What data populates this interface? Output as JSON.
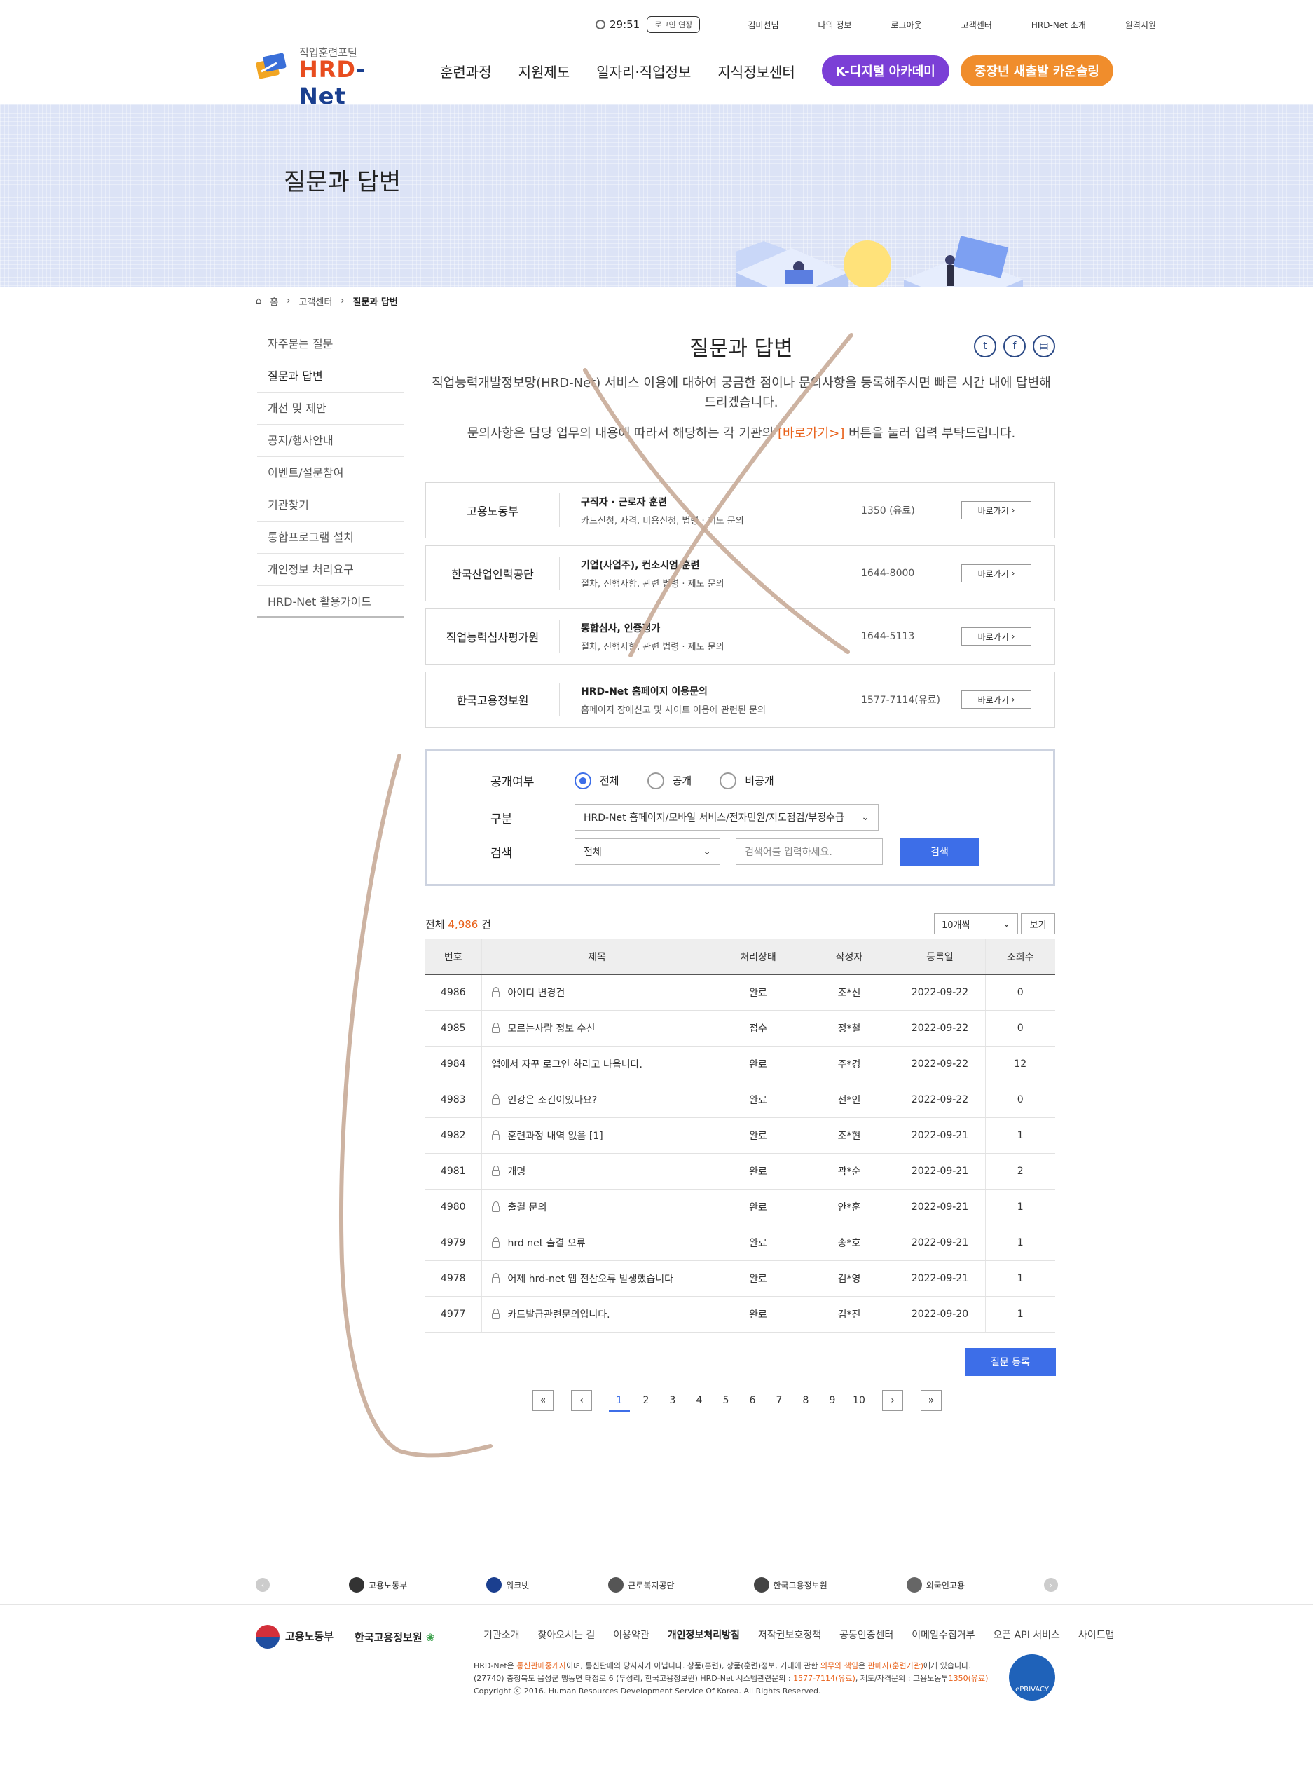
{
  "util": {
    "timer": "29:51",
    "extend_label": "로그인 연장",
    "user": "김미선님",
    "links": [
      "나의 정보",
      "로그아웃",
      "고객센터",
      "HRD-Net 소개",
      "원격지원"
    ]
  },
  "logo": {
    "small": "직업훈련포털",
    "brand_a": "HRD",
    "brand_b": "-Net"
  },
  "nav": {
    "items": [
      "훈련과정",
      "지원제도",
      "일자리·직업정보",
      "지식정보센터"
    ],
    "pill_digital": "K-디지털 아카데미",
    "pill_counsel": "중장년 새출발 카운슬링"
  },
  "banner": {
    "title": "질문과 답변"
  },
  "breadcrumb": {
    "home": "홈",
    "level1": "고객센터",
    "current": "질문과 답변"
  },
  "sidebar": {
    "items": [
      "자주묻는 질문",
      "질문과 답변",
      "개선 및 제안",
      "공지/행사안내",
      "이벤트/설문참여",
      "기관찾기",
      "통합프로그램 설치",
      "개인정보 처리요구",
      "HRD-Net 활용가이드"
    ]
  },
  "content": {
    "title": "질문과 답변",
    "intro": "직업능력개발정보망(HRD-Net) 서비스 이용에 대하여 궁금한 점이나 문의사항을 등록해주시면 빠른 시간 내에 답변해 드리겠습니다.",
    "intro2_a": "문의사항은 담당 업무의 내용에 따라서 해당하는 각 기관의",
    "intro2_hl": "[바로가기>]",
    "intro2_b": "버튼을 눌러 입력 부탁드립니다."
  },
  "agencies": [
    {
      "name": "고용노동부",
      "title": "구직자 · 근로자 훈련",
      "sub": "카드신청, 자격, 비용신청, 법령 · 제도 문의",
      "phone": "1350 (유료)",
      "go": "바로가기"
    },
    {
      "name": "한국산업인력공단",
      "title": "기업(사업주), 컨소시엄 훈련",
      "sub": "절차, 진행사항, 관련 법령 · 제도 문의",
      "phone": "1644-8000",
      "go": "바로가기"
    },
    {
      "name": "직업능력심사평가원",
      "title": "통합심사, 인증평가",
      "sub": "절차, 진행사항, 관련 법령 · 제도 문의",
      "phone": "1644-5113",
      "go": "바로가기"
    },
    {
      "name": "한국고용정보원",
      "title": "HRD-Net 홈페이지 이용문의",
      "sub": "홈페이지 장애신고 및 사이트 이용에 관련된 문의",
      "phone": "1577-7114(유료)",
      "go": "바로가기"
    }
  ],
  "search": {
    "public_label": "공개여부",
    "radio_all": "전체",
    "radio_public": "공개",
    "radio_private": "비공개",
    "category_label": "구분",
    "category_value": "HRD-Net 홈페이지/모바일 서비스/전자민원/지도점검/부정수급",
    "search_label": "검색",
    "field_value": "전체",
    "keyword_placeholder": "검색어를 입력하세요.",
    "button": "검색"
  },
  "list": {
    "total_prefix": "전체",
    "total_count": "4,986",
    "total_suffix": "건",
    "page_size": "10개씩",
    "view_button": "보기",
    "columns": [
      "번호",
      "제목",
      "처리상태",
      "작성자",
      "등록일",
      "조회수"
    ],
    "rows": [
      {
        "no": "4986",
        "title": "아이디 변경건",
        "locked": true,
        "status": "완료",
        "author": "조*신",
        "date": "2022-09-22",
        "views": "0"
      },
      {
        "no": "4985",
        "title": "모르는사람 정보 수신",
        "locked": true,
        "status": "접수",
        "author": "정*철",
        "date": "2022-09-22",
        "views": "0"
      },
      {
        "no": "4984",
        "title": "앱에서 자꾸 로그인 하라고 나옵니다.",
        "locked": false,
        "status": "완료",
        "author": "주*경",
        "date": "2022-09-22",
        "views": "12"
      },
      {
        "no": "4983",
        "title": "인강은 조건이있나요?",
        "locked": true,
        "status": "완료",
        "author": "전*인",
        "date": "2022-09-22",
        "views": "0"
      },
      {
        "no": "4982",
        "title": "훈련과정 내역 없음 [1]",
        "locked": true,
        "status": "완료",
        "author": "조*현",
        "date": "2022-09-21",
        "views": "1"
      },
      {
        "no": "4981",
        "title": "개명",
        "locked": true,
        "status": "완료",
        "author": "곽*순",
        "date": "2022-09-21",
        "views": "2"
      },
      {
        "no": "4980",
        "title": "출결 문의",
        "locked": true,
        "status": "완료",
        "author": "안*훈",
        "date": "2022-09-21",
        "views": "1"
      },
      {
        "no": "4979",
        "title": "hrd net 출결 오류",
        "locked": true,
        "status": "완료",
        "author": "송*호",
        "date": "2022-09-21",
        "views": "1"
      },
      {
        "no": "4978",
        "title": "어제 hrd-net 앱 전산오류 발생했습니다",
        "locked": true,
        "status": "완료",
        "author": "김*영",
        "date": "2022-09-21",
        "views": "1"
      },
      {
        "no": "4977",
        "title": "카드발급관련문의입니다.",
        "locked": true,
        "status": "완료",
        "author": "김*진",
        "date": "2022-09-20",
        "views": "1"
      }
    ],
    "register_button": "질문 등록",
    "pages": [
      "1",
      "2",
      "3",
      "4",
      "5",
      "6",
      "7",
      "8",
      "9",
      "10"
    ],
    "current_page": "1"
  },
  "footer": {
    "links": [
      "고용노동부",
      "워크넷",
      "근로복지공단",
      "한국고용정보원",
      "외국인고용"
    ],
    "org1": "고용노동부",
    "org2": "한국고용정보원",
    "menu": [
      "기관소개",
      "찾아오시는 길",
      "이용약관",
      "개인정보처리방침",
      "저작권보호정책",
      "공동인증센터",
      "이메일수집거부",
      "오픈 API 서비스",
      "사이트맵"
    ],
    "info_line1_a": "HRD-Net은",
    "info_line1_o1": "통신판매중개자",
    "info_line1_b": "이며, 통신판매의 당사자가 아닙니다. 상품(훈련), 상품(훈련)정보, 거래에 관한",
    "info_line1_o2": "의무와 책임",
    "info_line1_c": "은",
    "info_line1_o3": "판매자(훈련기관)",
    "info_line1_d": "에게 있습니다.",
    "info_line2_a": "(27740) 충청북도 음성군 맹동면 태정로 6 (두성리, 한국고용정보원) HRD-Net 시스템관련문의 :",
    "info_line2_o1": "1577-7114(유료)",
    "info_line2_b": ", 제도/자격문의 : 고용노동부",
    "info_line2_o2": "1350(유료)",
    "info_line3": "Copyright ⓒ 2016. Human Resources Development Service Of Korea. All Rights Reserved.",
    "eprivacy": "ePRIVACY"
  },
  "colors": {
    "primary": "#3d6ee8",
    "accent": "#e8611a",
    "purple": "#7b3fd6",
    "orange": "#f08d2c",
    "navy": "#1a3f8f",
    "scribble": "#c8ab98"
  }
}
